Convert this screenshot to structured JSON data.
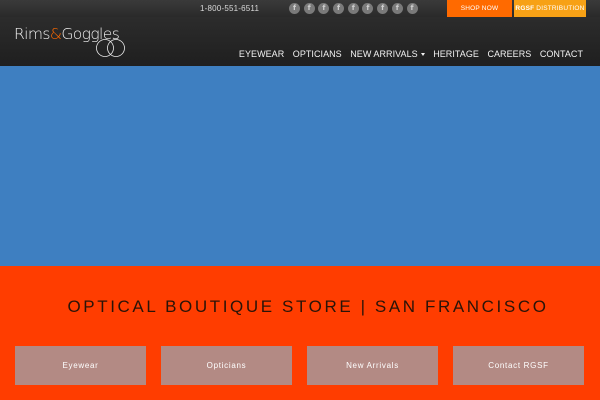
{
  "topbar": {
    "phone": "1-800-551-6511",
    "social_icons": [
      "f",
      "f",
      "f",
      "f",
      "f",
      "f",
      "f",
      "f",
      "f"
    ],
    "shop_label": "SHOP NOW",
    "dist_brand": "RGSF",
    "dist_label": "DISTRIBUTION"
  },
  "logo": {
    "name_part1": "Rims",
    "ampersand": "&",
    "name_part2": "Goggles"
  },
  "nav": {
    "items": [
      "EYEWEAR",
      "OPTICIANS",
      "NEW ARRIVALS",
      "HERITAGE",
      "CAREERS",
      "CONTACT"
    ]
  },
  "banner": {
    "title": "OPTICAL BOUTIQUE STORE | SAN FRANCISCO",
    "tiles": [
      "Eyewear",
      "Opticians",
      "New Arrivals",
      "Contact RGSF"
    ]
  },
  "colors": {
    "accent_orange": "#ff6a00",
    "distribution_orange": "#f7a116",
    "banner_red": "#ff3d00",
    "hero_blue": "#3e7fc1",
    "tile": "#b38a84"
  }
}
